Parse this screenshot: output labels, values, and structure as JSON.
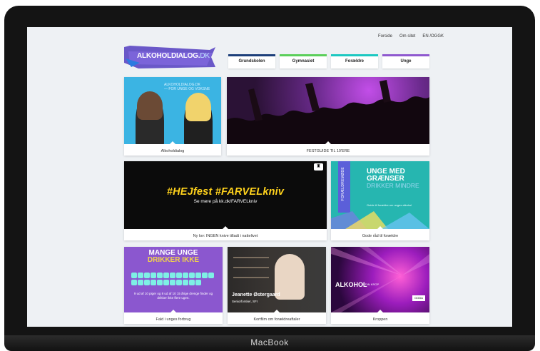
{
  "device": {
    "brand": "MacBook"
  },
  "top_links": [
    "Forside",
    "Om sitet",
    "EN /OGGK"
  ],
  "logo": {
    "text": "ALKOHOLDIALOG.",
    "suffix": "DK"
  },
  "nav": [
    {
      "label": "Grundskolen",
      "color": "#1d3f7a"
    },
    {
      "label": "Gymnasiet",
      "color": "#5bcf5a"
    },
    {
      "label": "Forældre",
      "color": "#1cc8c1"
    },
    {
      "label": "Unge",
      "color": "#8f59cf"
    }
  ],
  "tiles": {
    "alkoholdialog": {
      "caption": "Alkoholdialog",
      "text": "ALKOHOLDIALOG.DK",
      "sub": "— FOR UNGE OG VOKSNE"
    },
    "festguide": {
      "caption": "FESTGUIDE TIL 10'ERE"
    },
    "farvelkniv": {
      "headline": "#HEJfest #FARVELkniv",
      "subline": "Se mere på kk.dk/FARVELkniv",
      "caption": "Ny lov: INGEN knive tilladt i nattelivet",
      "crest": "♜"
    },
    "unge_med_graenser": {
      "title": "UNGE MED GRÆNSER",
      "subtitle": "DRIKKER MINDRE",
      "ribbon": "FORÆLDREMØDE",
      "small": "Guide til forældre om unges alkohol",
      "caption": "Gode råd til forældre"
    },
    "mange_unge": {
      "title": "MANGE UNGE",
      "subtitle": "DRIKKER IKKE",
      "text": "9 ud af 10 piger og 8 ud af 10 15 årige drenge finder og drikker ikke flere ugen.",
      "caption": "Fald i unges forbrug"
    },
    "jeanette": {
      "name": "Jeanette Østergaard",
      "role": "Seniorforsker, SFI",
      "caption": "Kortfilm om forældreaftaler"
    },
    "kroppen": {
      "title": "ALKOHOL",
      "sub": "& DIN KROP",
      "logo": "GODA",
      "caption": "Kroppen"
    }
  }
}
